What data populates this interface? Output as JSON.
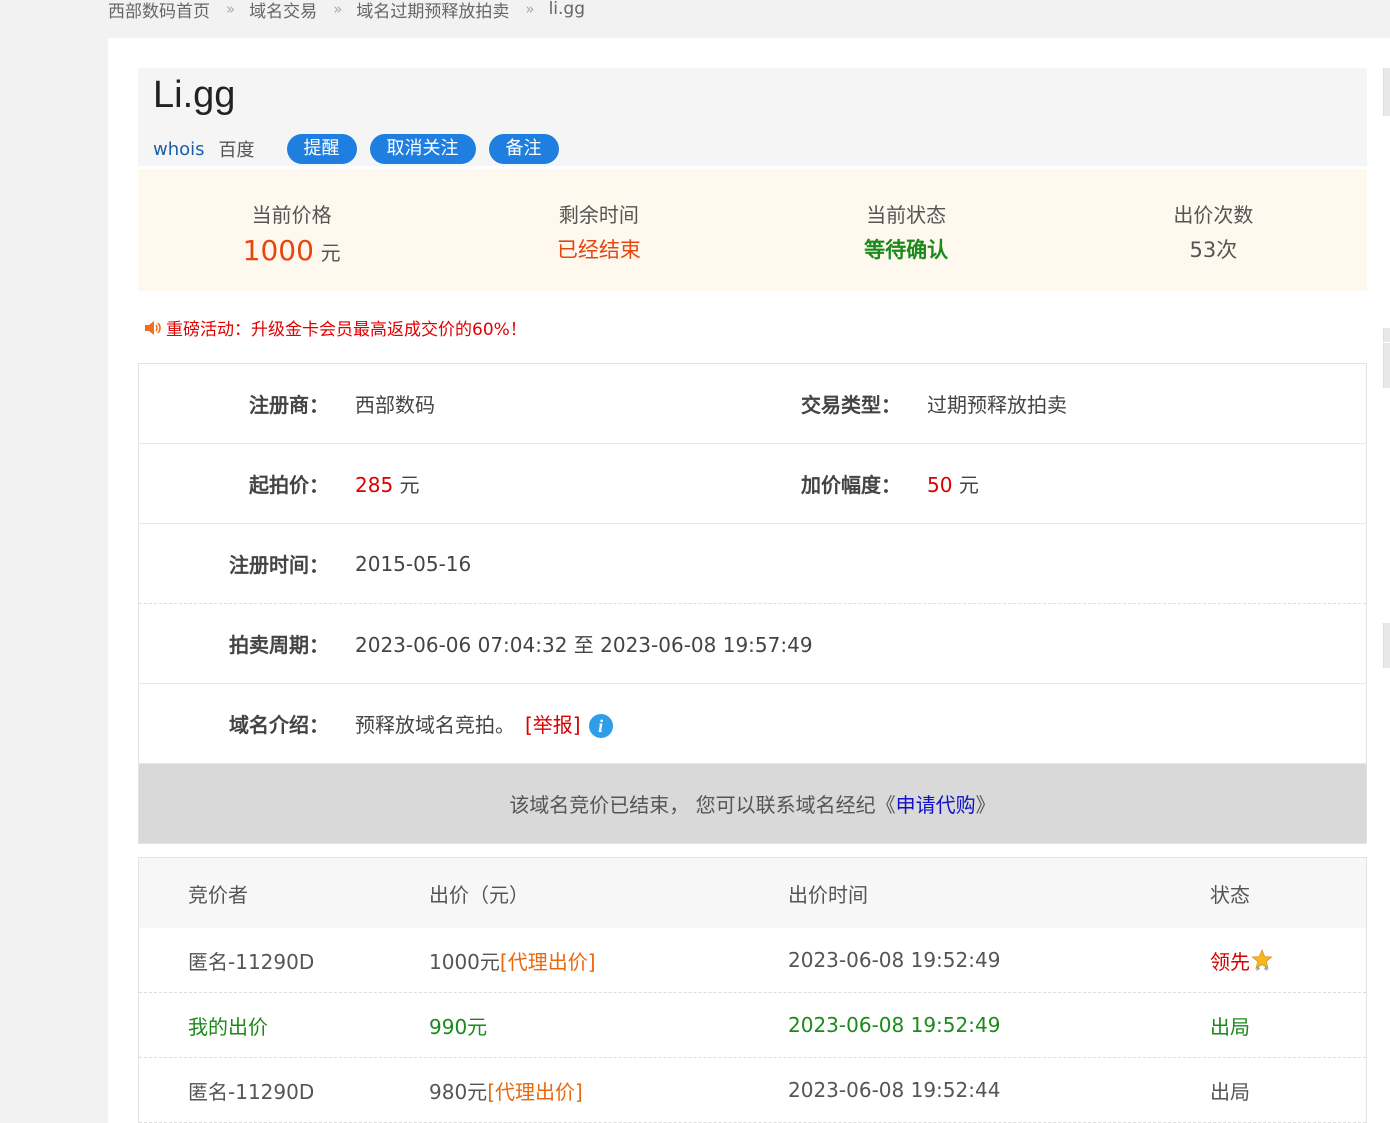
{
  "breadcrumb": {
    "items": [
      "西部数码首页",
      "域名交易",
      "域名过期预释放拍卖",
      "li.gg"
    ],
    "separator": "»"
  },
  "domain": {
    "title": "Li.gg",
    "links": {
      "whois": "whois",
      "baidu": "百度"
    },
    "buttons": {
      "remind": "提醒",
      "unfollow": "取消关注",
      "note": "备注"
    }
  },
  "stats": {
    "price_label": "当前价格",
    "price_value": "1000",
    "price_unit": "元",
    "time_label": "剩余时间",
    "time_value": "已经结束",
    "status_label": "当前状态",
    "status_value": "等待确认",
    "bids_label": "出价次数",
    "bids_value": "53次"
  },
  "promo": {
    "text": "重磅活动：升级金卡会员最高返成交价的60%！",
    "icon": "speaker-icon"
  },
  "info": {
    "registrar_label": "注册商：",
    "registrar_value": "西部数码",
    "type_label": "交易类型：",
    "type_value": "过期预释放拍卖",
    "start_price_label": "起拍价：",
    "start_price_value": "285",
    "start_price_unit": "元",
    "increment_label": "加价幅度：",
    "increment_value": "50",
    "increment_unit": "元",
    "reg_time_label": "注册时间：",
    "reg_time_value": "2015-05-16",
    "period_label": "拍卖周期：",
    "period_value": "2023-06-06 07:04:32 至 2023-06-08 19:57:49",
    "intro_label": "域名介绍：",
    "intro_value": "预释放域名竞拍。",
    "report": "[举报]"
  },
  "ended_notice": {
    "text": "该域名竞价已结束， 您可以联系域名经纪《",
    "link": "申请代购",
    "suffix": "》"
  },
  "bid_table": {
    "headers": [
      "竞价者",
      "出价（元）",
      "出价时间",
      "状态"
    ],
    "rows": [
      {
        "bidder": "匿名-11290D",
        "amount": "1000元",
        "proxy": "[代理出价]",
        "time": "2023-06-08 19:52:49",
        "status": "领先",
        "mine": false
      },
      {
        "bidder": "我的出价",
        "amount": "990元",
        "proxy": "",
        "time": "2023-06-08 19:52:49",
        "status": "出局",
        "mine": true
      },
      {
        "bidder": "匿名-11290D",
        "amount": "980元",
        "proxy": "[代理出价]",
        "time": "2023-06-08 19:52:44",
        "status": "出局",
        "mine": false
      }
    ]
  },
  "colors": {
    "accent_blue": "#1e7fe0",
    "price_orange": "#e8460f",
    "green": "#1b8a1b",
    "red": "#d90000"
  }
}
